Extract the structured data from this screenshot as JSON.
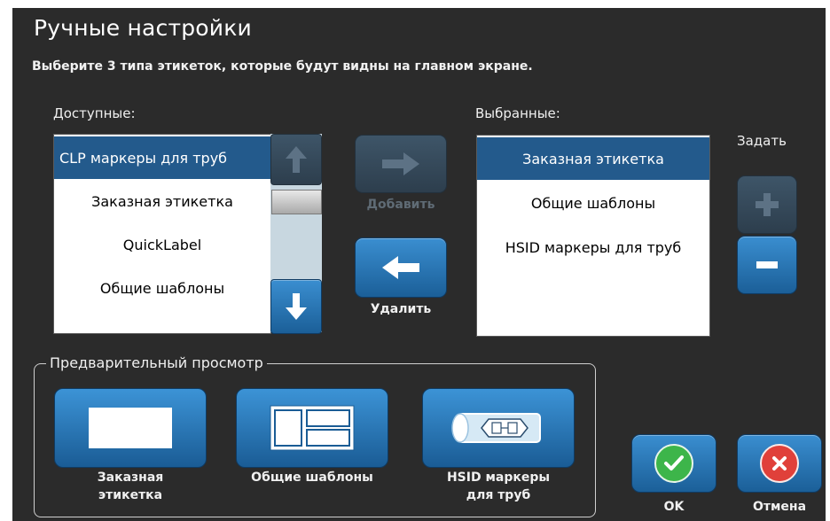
{
  "dialog": {
    "title": "Ручные настройки",
    "subtitle": "Выберите 3 типа этикеток, которые будут видны на главном экране."
  },
  "available": {
    "label": "Доступные:",
    "items": [
      "CLP маркеры для труб",
      "Заказная этикетка",
      "QuickLabel",
      "Общие шаблоны"
    ],
    "selected_index": 0
  },
  "selected": {
    "label": "Выбранные:",
    "items": [
      "Заказная этикетка",
      "Общие шаблоны",
      "HSID маркеры для труб"
    ],
    "selected_index": 0
  },
  "actions": {
    "add_label": "Добавить",
    "remove_label": "Удалить"
  },
  "set": {
    "label": "Задать"
  },
  "preview": {
    "legend": "Предварительный просмотр",
    "items": [
      {
        "caption_line1": "Заказная",
        "caption_line2": "этикетка"
      },
      {
        "caption_line1": "Общие шаблоны",
        "caption_line2": ""
      },
      {
        "caption_line1": "HSID маркеры",
        "caption_line2": "для труб"
      }
    ]
  },
  "footer": {
    "ok_label": "OK",
    "cancel_label": "Отмена"
  },
  "colors": {
    "background": "#2b2b2b",
    "selection": "#235a8c",
    "button_blue": "#1f6aa8",
    "ok_green": "#3db54a",
    "cancel_red": "#e0403a"
  }
}
